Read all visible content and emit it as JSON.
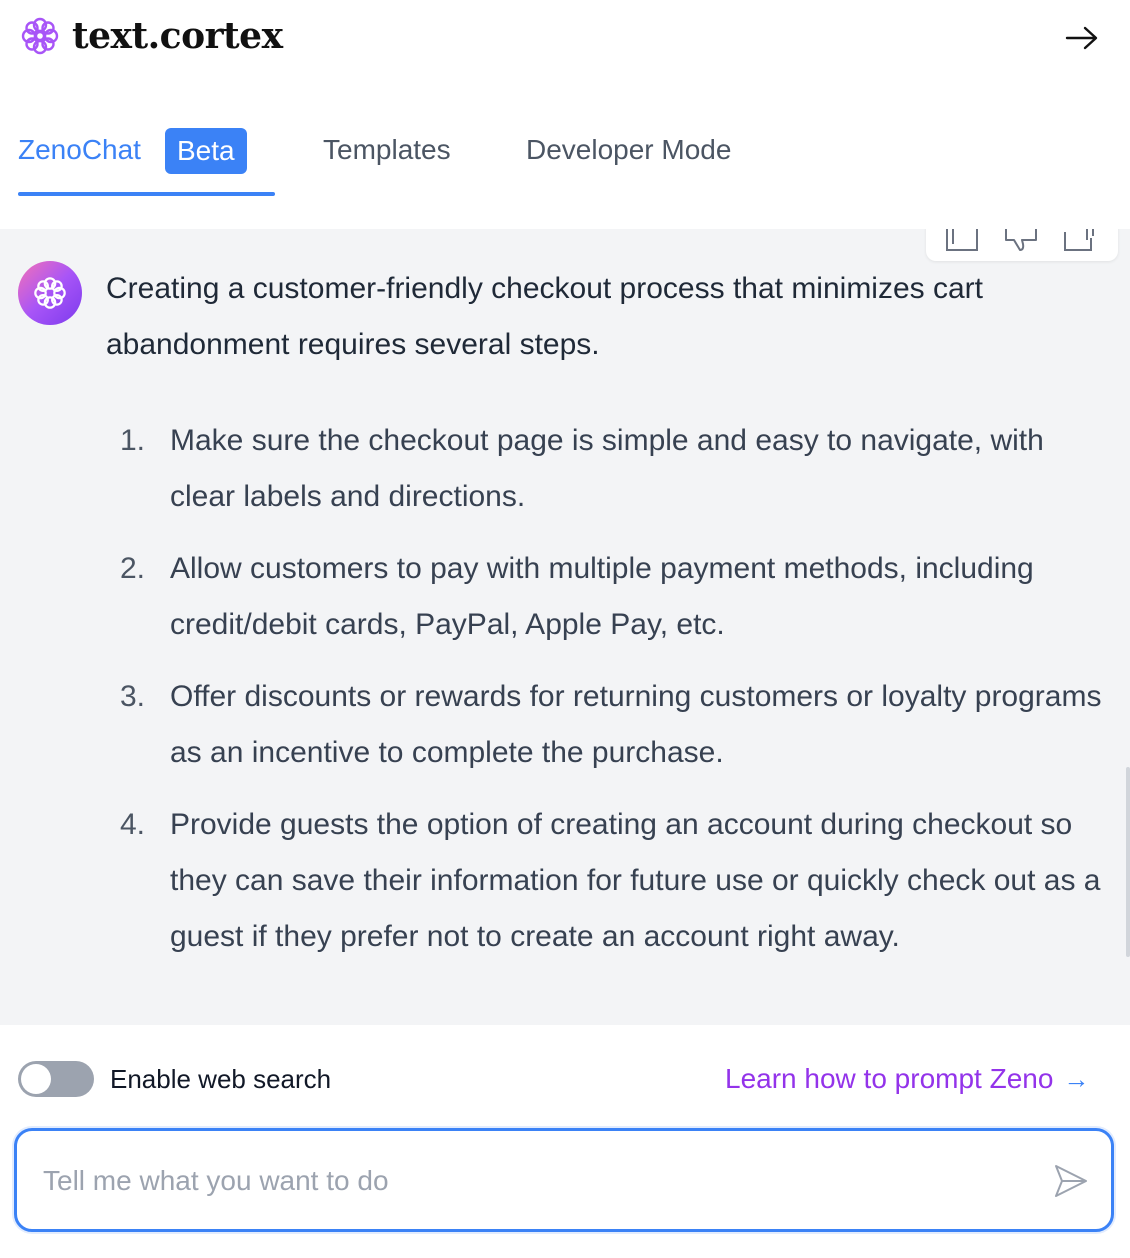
{
  "brand": {
    "name": "text.cortex",
    "logo_icon": "cortex-flower-icon",
    "accent": "#3b82f6",
    "logo_color": "#a855f7"
  },
  "header": {
    "collapse_icon": "arrow-right-icon"
  },
  "tabs": [
    {
      "label": "ZenoChat",
      "badge": "Beta",
      "active": true
    },
    {
      "label": "Templates",
      "active": false
    },
    {
      "label": "Developer Mode",
      "active": false
    }
  ],
  "message_actions": [
    {
      "icon": "copy-icon"
    },
    {
      "icon": "thumbs-down-icon"
    },
    {
      "icon": "share-icon"
    }
  ],
  "message": {
    "avatar_icon": "cortex-flower-icon",
    "intro": "Creating a customer-friendly checkout process that minimizes cart abandonment requires several steps.",
    "steps": [
      {
        "num": "1.",
        "text": "Make sure the checkout page is simple and easy to navigate, with clear labels and directions."
      },
      {
        "num": "2.",
        "text": "Allow customers to pay with multiple payment methods, including credit/debit cards, PayPal, Apple Pay, etc."
      },
      {
        "num": "3.",
        "text": "Offer discounts or rewards for returning customers or loyalty programs as an incentive to complete the purchase."
      },
      {
        "num": "4.",
        "text": "Provide guests the option of creating an account during checkout so they can save their information for future use or quickly check out as a guest if they prefer not to create an account right away."
      }
    ]
  },
  "web_search": {
    "label": "Enable web search",
    "enabled": false
  },
  "learn_link": {
    "label": "Learn how to prompt Zeno",
    "arrow": "→",
    "color": "#9333ea"
  },
  "composer": {
    "placeholder": "Tell me what you want to do",
    "value": "",
    "send_icon": "send-icon"
  }
}
